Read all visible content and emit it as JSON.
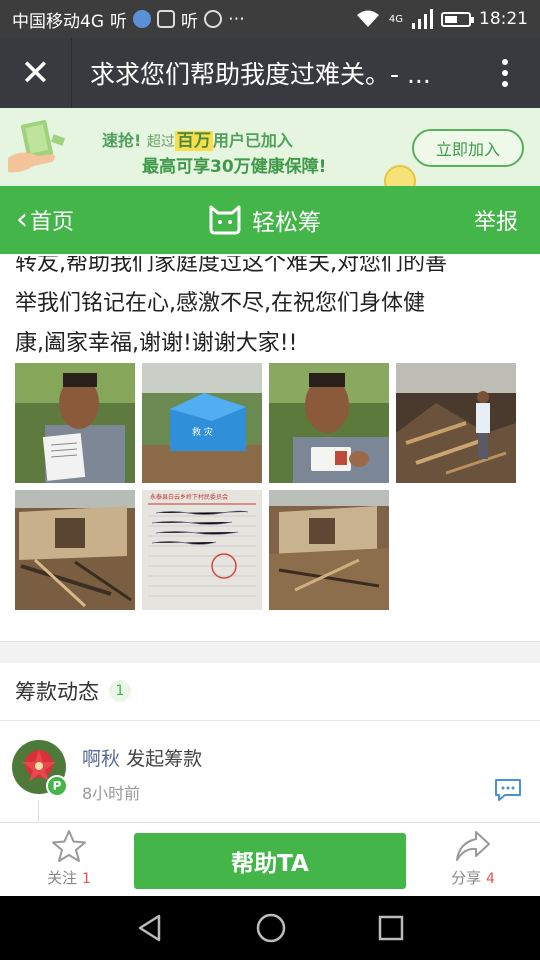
{
  "status_bar": {
    "carrier": "中国移动4G",
    "extra": "⋯",
    "network": "4G",
    "time": "18:21"
  },
  "title_bar": {
    "title": "求求您们帮助我度过难关。- ..."
  },
  "banner": {
    "prefix": "速抢!",
    "joined_pre": "超过",
    "joined_highlight": "百万",
    "joined_post": "用户已加入",
    "line2": "最高可享30万健康保障!",
    "join_button": "立即加入"
  },
  "nav": {
    "back_label": "首页",
    "brand": "轻松筹",
    "report_label": "举报"
  },
  "story": {
    "line1": "转友,帮助我们家庭度过这个难关,对您们的善",
    "line2": "举我们铭记在心,感激不尽,在祝您们身体健",
    "line3": "康,阖家幸福,谢谢!谢谢大家!!"
  },
  "gallery": {
    "tent_text": "救 灾",
    "letter_header": "永泰县白云乡岭下村民委员会"
  },
  "feed": {
    "section_title": "筹款动态",
    "count": "1",
    "user_name": "啊秋",
    "action": "发起筹款",
    "time_ago": "8小时前",
    "user_badge": "P"
  },
  "action_bar": {
    "follow_label": "关注",
    "follow_count": "1",
    "help_label": "帮助TA",
    "share_label": "分享",
    "share_count": "4"
  },
  "colors": {
    "primary_green": "#43b549",
    "title_bar": "#393a3f",
    "status_bar": "#3d3d3d",
    "banner_bg": "#e6f5df",
    "count_red": "#e8554e"
  }
}
